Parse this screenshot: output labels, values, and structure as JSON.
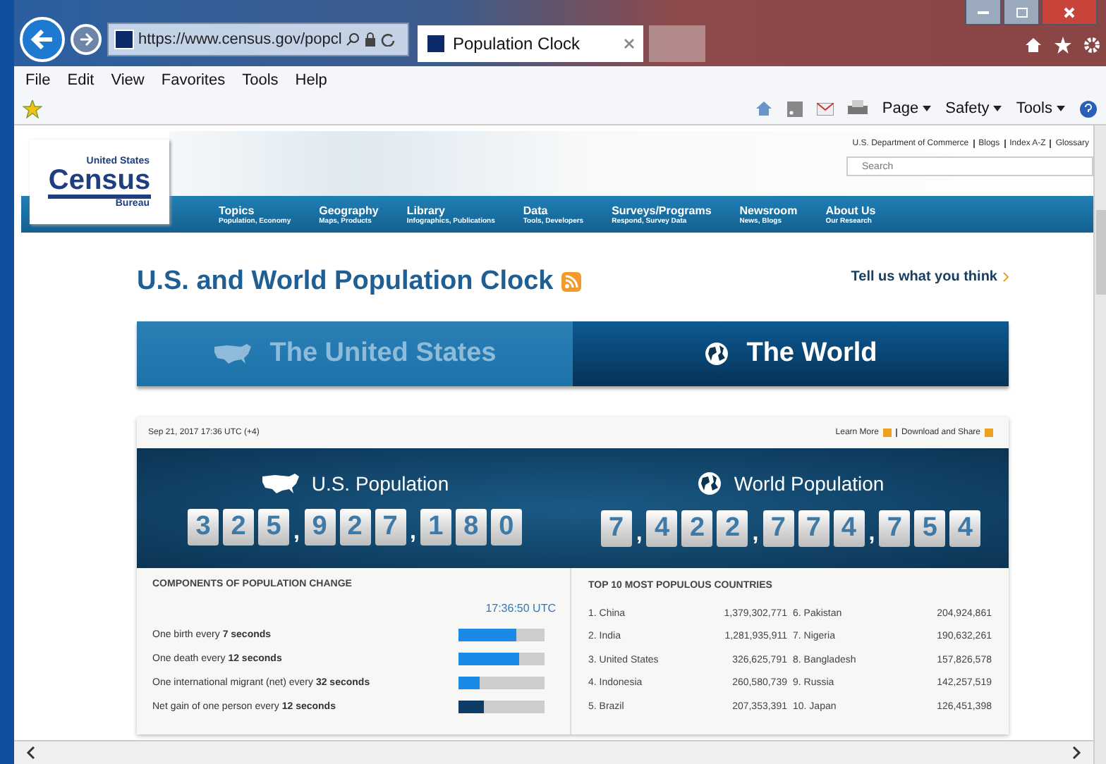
{
  "browser": {
    "address": "https://www.census.gov/popcl",
    "tab_title": "Population Clock",
    "menu": [
      "File",
      "Edit",
      "View",
      "Favorites",
      "Tools",
      "Help"
    ],
    "commands": [
      "Page",
      "Safety",
      "Tools"
    ]
  },
  "site": {
    "logo": {
      "top": "United States",
      "main": "Census",
      "bottom": "Bureau"
    },
    "top_links": [
      "U.S. Department of Commerce",
      "Blogs",
      "Index A-Z",
      "Glossary"
    ],
    "search": {
      "placeholder": "Search"
    },
    "nav": [
      {
        "label": "Topics",
        "sub": "Population, Economy"
      },
      {
        "label": "Geography",
        "sub": "Maps, Products"
      },
      {
        "label": "Library",
        "sub": "Infographics, Publications"
      },
      {
        "label": "Data",
        "sub": "Tools, Developers"
      },
      {
        "label": "Surveys/Programs",
        "sub": "Respond, Survey Data"
      },
      {
        "label": "Newsroom",
        "sub": "News, Blogs"
      },
      {
        "label": "About Us",
        "sub": "Our Research"
      }
    ]
  },
  "page": {
    "title": "U.S. and World Population Clock",
    "feedback": "Tell us what you think",
    "tabs": [
      {
        "label": "The United States",
        "kind": "us",
        "selected": false
      },
      {
        "label": "The World",
        "kind": "world",
        "selected": true
      }
    ],
    "timestamp": "Sep 21, 2017 17:36 UTC (+4)",
    "links": [
      "Learn More",
      "Download and Share"
    ],
    "us": {
      "title": "U.S. Population",
      "digits": [
        "3",
        "2",
        "5",
        ",",
        "9",
        "2",
        "7",
        ",",
        "1",
        "8",
        "0"
      ]
    },
    "world": {
      "title": "World Population",
      "digits": [
        "7",
        ",",
        "4",
        "2",
        "2",
        ",",
        "7",
        "7",
        "4",
        ",",
        "7",
        "5",
        "4"
      ]
    },
    "components": {
      "heading": "COMPONENTS OF POPULATION CHANGE",
      "time": "17:36:50 UTC",
      "rows": [
        {
          "text": "One birth every **7 seconds**",
          "level": 0.67,
          "color": "#1a8ae6"
        },
        {
          "text": "One death every **12 seconds**",
          "level": 0.7,
          "color": "#1a8ae6"
        },
        {
          "text": "One international migrant (net) every **32 seconds**",
          "level": 0.24,
          "color": "#1a8ae6"
        },
        {
          "text": "Net gain of one person every **12 seconds**",
          "level": 0.3,
          "color": "#0d3d66"
        }
      ]
    },
    "countries": {
      "heading": "TOP 10 MOST POPULOUS COUNTRIES",
      "rows": [
        {
          "name": "1. China",
          "population": "1,379,302,771"
        },
        {
          "name": "2. India",
          "population": "1,281,935,911"
        },
        {
          "name": "3. United States",
          "population": "326,625,791"
        },
        {
          "name": "4. Indonesia",
          "population": "260,580,739"
        },
        {
          "name": "5. Brazil",
          "population": "207,353,391"
        },
        {
          "name": "6. Pakistan",
          "population": "204,924,861"
        },
        {
          "name": "7. Nigeria",
          "population": "190,632,261"
        },
        {
          "name": "8. Bangladesh",
          "population": "157,826,578"
        },
        {
          "name": "9. Russia",
          "population": "142,257,519"
        },
        {
          "name": "10. Japan",
          "population": "126,451,398"
        }
      ]
    }
  }
}
